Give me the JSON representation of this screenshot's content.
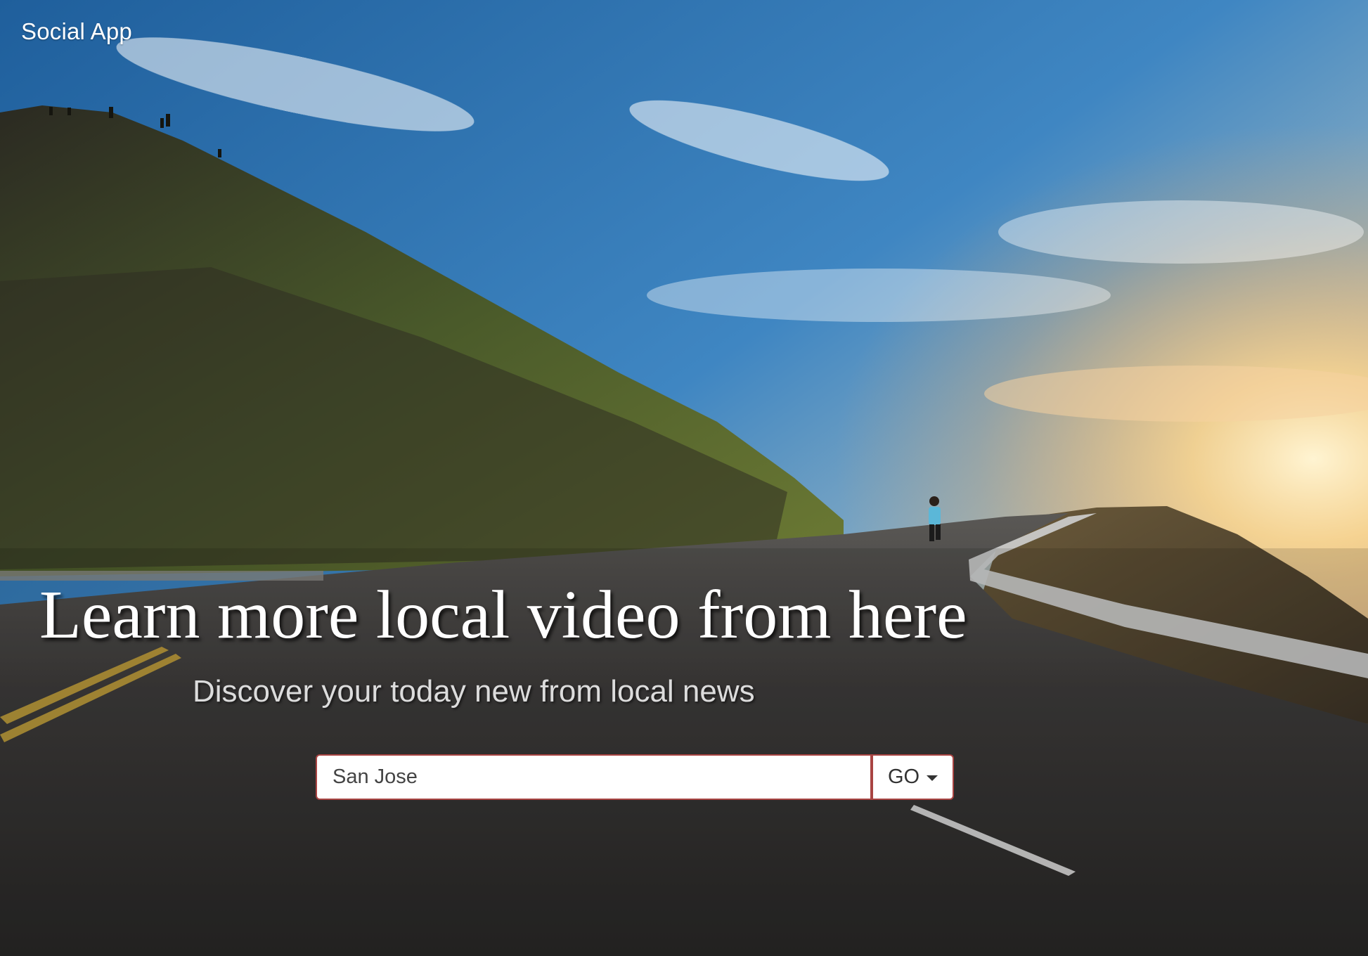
{
  "navbar": {
    "brand": "Social App"
  },
  "hero": {
    "headline": "Learn more local video from here",
    "subheadline": "Discover your today new from local news"
  },
  "search": {
    "value": "San Jose",
    "button_label": "GO",
    "button_icon": "caret-down-icon",
    "border_color": "#a94442"
  }
}
